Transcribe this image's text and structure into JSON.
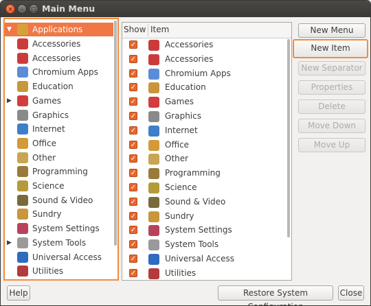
{
  "window": {
    "title": "Main Menu"
  },
  "tree": {
    "root": {
      "label": "Applications",
      "icon": "applications-icon",
      "color": "#d7a13a"
    },
    "items": [
      {
        "label": "Accessories",
        "icon": "accessories-icon",
        "color": "#cc3b3b",
        "expander": ""
      },
      {
        "label": "Accessories",
        "icon": "accessories-icon",
        "color": "#cc3b3b",
        "expander": ""
      },
      {
        "label": "Chromium Apps",
        "icon": "chromium-icon",
        "color": "#5b8dd6",
        "expander": ""
      },
      {
        "label": "Education",
        "icon": "education-icon",
        "color": "#c8963c",
        "expander": ""
      },
      {
        "label": "Games",
        "icon": "games-icon",
        "color": "#d23d3d",
        "expander": "▶"
      },
      {
        "label": "Graphics",
        "icon": "graphics-icon",
        "color": "#8a8a8a",
        "expander": ""
      },
      {
        "label": "Internet",
        "icon": "internet-icon",
        "color": "#3f7fc8",
        "expander": ""
      },
      {
        "label": "Office",
        "icon": "office-icon",
        "color": "#d49a3a",
        "expander": ""
      },
      {
        "label": "Other",
        "icon": "other-icon",
        "color": "#c7a552",
        "expander": ""
      },
      {
        "label": "Programming",
        "icon": "programming-icon",
        "color": "#9a7a3a",
        "expander": ""
      },
      {
        "label": "Science",
        "icon": "science-icon",
        "color": "#b59a3a",
        "expander": ""
      },
      {
        "label": "Sound & Video",
        "icon": "sound-video-icon",
        "color": "#7a6a3a",
        "expander": ""
      },
      {
        "label": "Sundry",
        "icon": "sundry-icon",
        "color": "#c8963c",
        "expander": ""
      },
      {
        "label": "System Settings",
        "icon": "system-settings-icon",
        "color": "#b8425c",
        "expander": ""
      },
      {
        "label": "System Tools",
        "icon": "system-tools-icon",
        "color": "#9a9a9a",
        "expander": "▶"
      },
      {
        "label": "Universal Access",
        "icon": "universal-access-icon",
        "color": "#2f6bbf",
        "expander": ""
      },
      {
        "label": "Utilities",
        "icon": "utilities-icon",
        "color": "#b33b3b",
        "expander": ""
      }
    ]
  },
  "list": {
    "header_show": "Show",
    "header_item": "Item",
    "rows": [
      {
        "label": "Accessories",
        "icon": "accessories-icon",
        "color": "#cc3b3b",
        "checked": true
      },
      {
        "label": "Accessories",
        "icon": "accessories-icon",
        "color": "#cc3b3b",
        "checked": true
      },
      {
        "label": "Chromium Apps",
        "icon": "chromium-icon",
        "color": "#5b8dd6",
        "checked": true
      },
      {
        "label": "Education",
        "icon": "education-icon",
        "color": "#c8963c",
        "checked": true
      },
      {
        "label": "Games",
        "icon": "games-icon",
        "color": "#d23d3d",
        "checked": true
      },
      {
        "label": "Graphics",
        "icon": "graphics-icon",
        "color": "#8a8a8a",
        "checked": true
      },
      {
        "label": "Internet",
        "icon": "internet-icon",
        "color": "#3f7fc8",
        "checked": true
      },
      {
        "label": "Office",
        "icon": "office-icon",
        "color": "#d49a3a",
        "checked": true
      },
      {
        "label": "Other",
        "icon": "other-icon",
        "color": "#c7a552",
        "checked": true
      },
      {
        "label": "Programming",
        "icon": "programming-icon",
        "color": "#9a7a3a",
        "checked": true
      },
      {
        "label": "Science",
        "icon": "science-icon",
        "color": "#b59a3a",
        "checked": true
      },
      {
        "label": "Sound & Video",
        "icon": "sound-video-icon",
        "color": "#7a6a3a",
        "checked": true
      },
      {
        "label": "Sundry",
        "icon": "sundry-icon",
        "color": "#c8963c",
        "checked": true
      },
      {
        "label": "System Settings",
        "icon": "system-settings-icon",
        "color": "#b8425c",
        "checked": true
      },
      {
        "label": "System Tools",
        "icon": "system-tools-icon",
        "color": "#9a9a9a",
        "checked": true
      },
      {
        "label": "Universal Access",
        "icon": "universal-access-icon",
        "color": "#2f6bbf",
        "checked": true
      },
      {
        "label": "Utilities",
        "icon": "utilities-icon",
        "color": "#b33b3b",
        "checked": true
      }
    ]
  },
  "buttons": {
    "new_menu": "New Menu",
    "new_item": "New Item",
    "new_separator": "New Separator",
    "properties": "Properties",
    "delete": "Delete",
    "move_down": "Move Down",
    "move_up": "Move Up"
  },
  "footer": {
    "help": "Help",
    "restore": "Restore System Configuration",
    "close": "Close"
  }
}
